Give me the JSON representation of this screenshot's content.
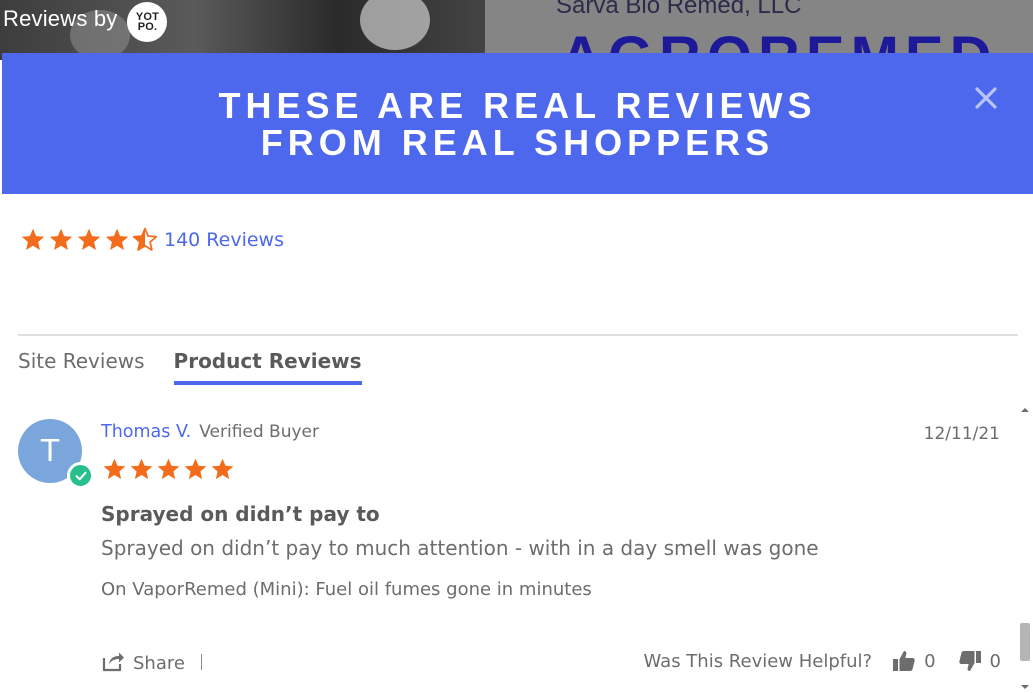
{
  "background": {
    "reviews_by": "Reviews by",
    "yotpo_logo_line1": "YOT",
    "yotpo_logo_line2": "PO.",
    "company_name": "Sarva Bio Remed, LLC",
    "company_brand": "AGROREMED"
  },
  "modal": {
    "title_line1": "THESE ARE REAL REVIEWS",
    "title_line2": "FROM REAL SHOPPERS",
    "close_icon": "close-icon",
    "accent_color": "#4d68ec"
  },
  "summary": {
    "rating": 4.5,
    "max_rating": 5,
    "review_count_label": "140 Reviews",
    "star_color": "#f26c1b"
  },
  "tabs": [
    {
      "label": "Site Reviews",
      "active": false
    },
    {
      "label": "Product Reviews",
      "active": true
    }
  ],
  "review": {
    "avatar_initial": "T",
    "reviewer_name": "Thomas V.",
    "verified_label": "Verified Buyer",
    "date": "12/11/21",
    "rating": 5,
    "title": "Sprayed on didn’t pay to",
    "body": "Sprayed on didn’t pay to much attention - with in a day smell was gone",
    "product": "On VaporRemed (Mini): Fuel oil fumes gone in minutes",
    "share_label": "Share",
    "helpful_label": "Was This Review Helpful?",
    "thumbs_up_count": "0",
    "thumbs_down_count": "0"
  }
}
